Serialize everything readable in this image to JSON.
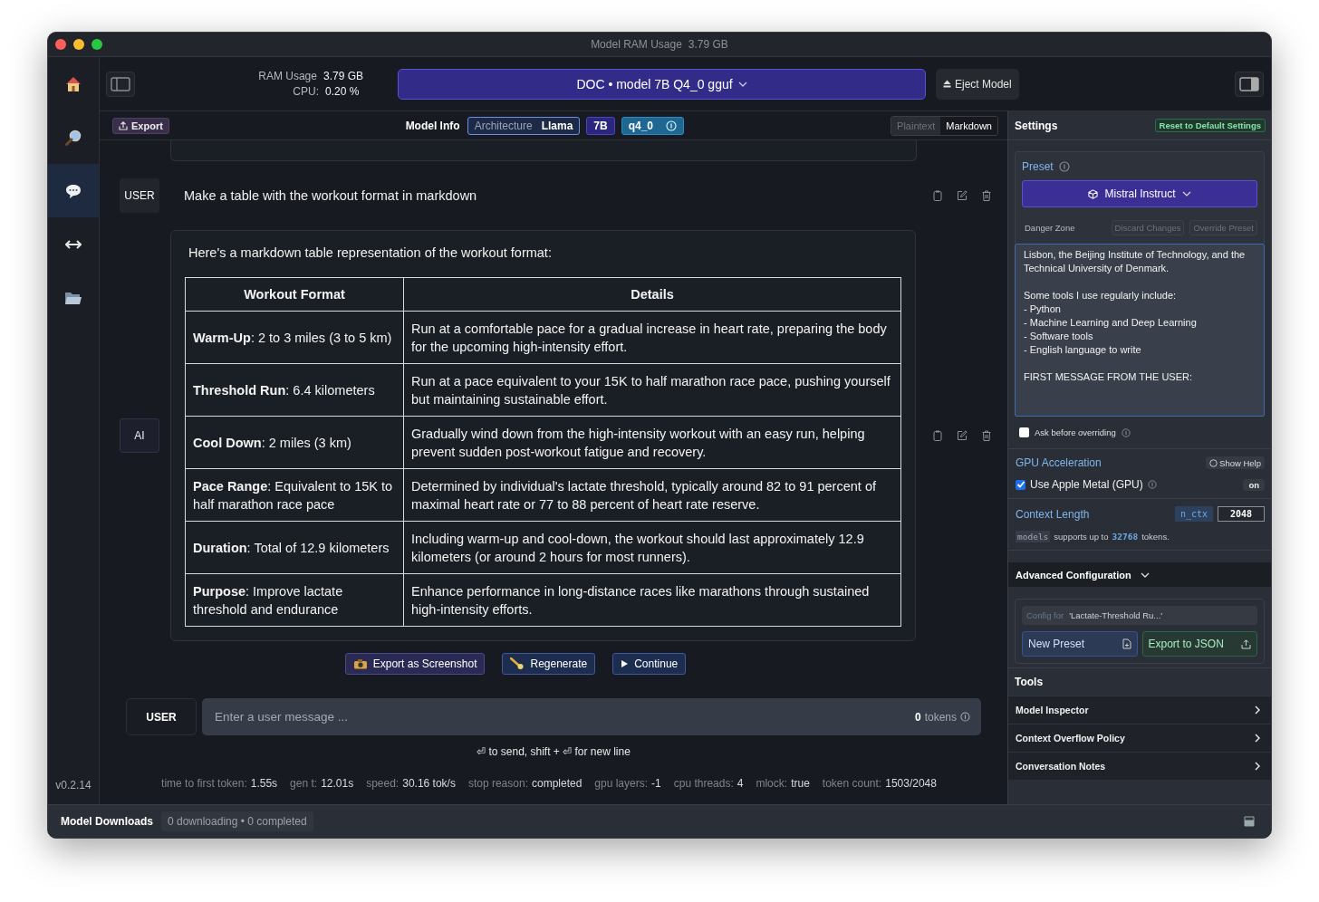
{
  "window": {
    "title": "Model RAM Usage",
    "title_value": "3.79 GB"
  },
  "nav": [
    {
      "kind": "home",
      "selected": false
    },
    {
      "kind": "search",
      "selected": false
    },
    {
      "kind": "chat",
      "selected": true
    },
    {
      "kind": "arrows",
      "selected": false
    },
    {
      "kind": "folder",
      "selected": false
    }
  ],
  "version": "v0.2.14",
  "topbar": {
    "ram_label": "RAM Usage",
    "ram_value": "3.79 GB",
    "cpu_label": "CPU:",
    "cpu_value": "0.20 %",
    "model": "DOC • model 7B Q4_0 gguf",
    "eject": "Eject Model"
  },
  "chat_header": {
    "export": "Export",
    "model_info": "Model Info",
    "arch_label": "Architecture",
    "arch_value": "Llama",
    "size": "7B",
    "quant": "q4_0",
    "view_modes": [
      {
        "label": "Plaintext",
        "selected": false
      },
      {
        "label": "Markdown",
        "selected": true
      }
    ]
  },
  "messages": [
    {
      "role": "USER",
      "kind": "text",
      "text": "Make a table with the workout format in markdown"
    },
    {
      "role": "AI",
      "kind": "table",
      "intro": "Here's a markdown table representation of the workout format:",
      "columns": [
        "Workout Format",
        "Details"
      ],
      "rows": [
        [
          "**Warm-Up**: 2 to 3 miles (3 to 5 km)",
          "Run at a comfortable pace for a gradual increase in heart rate, preparing the body for the upcoming high-intensity effort."
        ],
        [
          "**Threshold Run**: 6.4 kilometers",
          "Run at a pace equivalent to your 15K to half marathon race pace, pushing yourself but maintaining sustainable effort."
        ],
        [
          "**Cool Down**: 2 miles (3 km)",
          "Gradually wind down from the high-intensity workout with an easy run, helping prevent sudden post-workout fatigue and recovery."
        ],
        [
          "**Pace Range**: Equivalent to 15K to half marathon race pace",
          "Determined by individual's lactate threshold, typically around 82 to 91 percent of maximal heart rate or 77 to 88 percent of heart rate reserve."
        ],
        [
          "**Duration**: Total of 12.9 kilometers",
          "Including warm-up and cool-down, the workout should last approximately 12.9 kilometers (or around 2 hours for most runners)."
        ],
        [
          "**Purpose**: Improve lactate threshold and endurance",
          "Enhance performance in long-distance races like marathons through sustained high-intensity efforts."
        ]
      ]
    }
  ],
  "actions": [
    {
      "kind": "camera",
      "label": "Export as Screenshot"
    },
    {
      "kind": "comet",
      "label": "Regenerate"
    },
    {
      "kind": "play",
      "label": "Continue"
    }
  ],
  "composer": {
    "role": "USER",
    "placeholder": "Enter a user message ...",
    "token_count": "0",
    "token_label": "tokens",
    "hint": "⏎ to send, shift + ⏎ for new line"
  },
  "stats": [
    {
      "label": "time to first token:",
      "value": "1.55s"
    },
    {
      "label": "gen t:",
      "value": "12.01s"
    },
    {
      "label": "speed:",
      "value": "30.16 tok/s"
    },
    {
      "label": "stop reason:",
      "value": "completed"
    },
    {
      "label": "gpu layers:",
      "value": "-1"
    },
    {
      "label": "cpu threads:",
      "value": "4"
    },
    {
      "label": "mlock:",
      "value": "true"
    },
    {
      "label": "token count:",
      "value": "1503/2048"
    }
  ],
  "settings": {
    "title": "Settings",
    "reset": "Reset to Default Settings",
    "preset_label": "Preset",
    "preset": "Mistral Instruct",
    "danger_label": "Danger Zone",
    "discard": "Discard Changes",
    "override": "Override Preset",
    "system_prompt": "Lisbon, the Beijing Institute of Technology, and the Technical University of Denmark.\n\nSome tools I use regularly include:\n- Python\n- Machine Learning and Deep Learning\n- Software tools\n- English language to write\n\nFIRST MESSAGE FROM THE USER:",
    "ask_before": {
      "label": "Ask before overriding",
      "checked": false
    },
    "gpu_title": "GPU Acceleration",
    "show_help": "Show Help",
    "gpu": {
      "label": "Use Apple Metal (GPU)",
      "checked": true
    },
    "gpu_state": "on",
    "context_title": "Context Length",
    "ctx_key": "n_ctx",
    "ctx_value": "2048",
    "model_tag": "models",
    "supports": "supports up to",
    "max_tokens": "32768",
    "tokens_word": "tokens.",
    "advanced": "Advanced Configuration",
    "config_label": "Config for",
    "config_name": "'Lactate-Threshold Ru...'",
    "new_preset": "New Preset",
    "export_json": "Export to JSON",
    "tools_title": "Tools",
    "tools": [
      "Model Inspector",
      "Context Overflow Policy",
      "Conversation Notes"
    ]
  },
  "bottom": {
    "title": "Model Downloads",
    "status": "0 downloading • 0 completed"
  }
}
